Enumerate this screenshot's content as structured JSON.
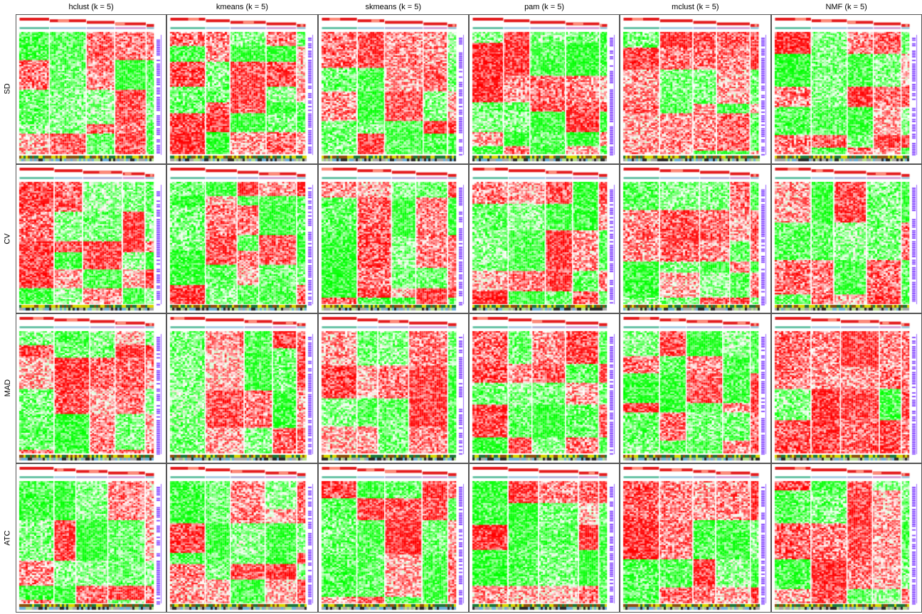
{
  "figure": {
    "columns": [
      "hclust (k = 5)",
      "kmeans (k = 5)",
      "skmeans (k = 5)",
      "pam (k = 5)",
      "mclust (k = 5)",
      "NMF (k = 5)"
    ],
    "rows": [
      "SD",
      "CV",
      "MAD",
      "ATC"
    ],
    "k": 5
  },
  "colors": {
    "heat_low": "#00ff00",
    "heat_mid": "#ffffff",
    "heat_high": "#ff0000",
    "row_annotation": "#7f3fff",
    "class_bar": "#e31a1c",
    "panel_border": "#555555",
    "silhouette_palette": [
      "#66c2a5",
      "#a6cee3",
      "#b2b2d9",
      "#d6a0d6",
      "#9ec8d9"
    ],
    "sample_annotation": [
      "#1b7837",
      "#d9d900",
      "#8c510a",
      "#2b2b2b",
      "#6baed6",
      "#b2df8a",
      "#a6a6a6"
    ]
  }
}
